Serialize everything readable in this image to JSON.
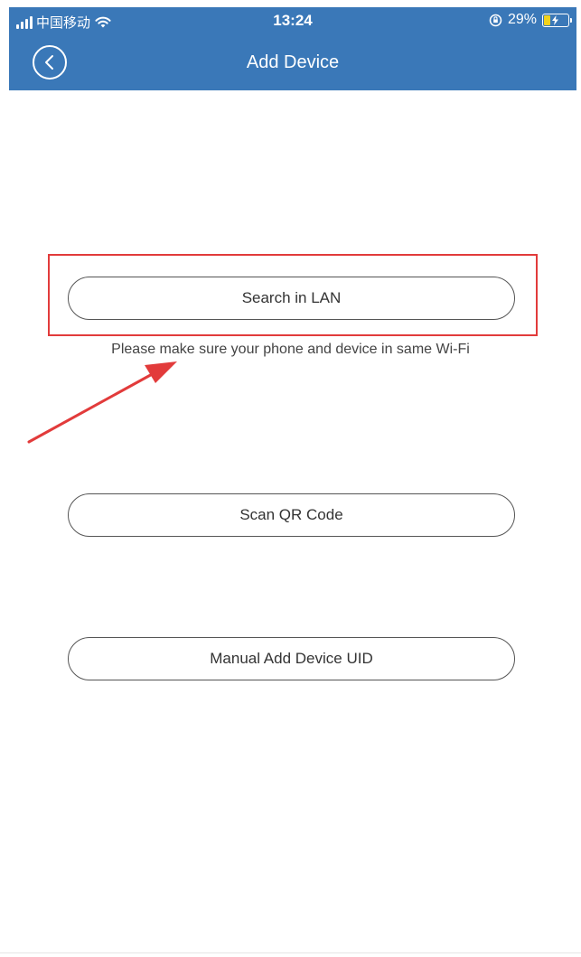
{
  "status_bar": {
    "carrier": "中国移动",
    "time": "13:24",
    "battery_percent": "29%",
    "battery_level": 0.29,
    "icons": [
      "signal-icon",
      "wifi-icon",
      "orientation-lock-icon",
      "battery-icon"
    ]
  },
  "nav": {
    "title": "Add Device",
    "back_icon": "back-chevron-icon"
  },
  "actions": {
    "search_lan_label": "Search in LAN",
    "search_lan_hint": "Please make sure your phone and device in same Wi-Fi",
    "scan_qr_label": "Scan QR Code",
    "manual_uid_label": "Manual Add Device UID"
  },
  "colors": {
    "header_bg": "#3a78b8",
    "highlight": "#e23b3b",
    "button_border": "#555555",
    "battery_fill": "#f2d21c"
  }
}
